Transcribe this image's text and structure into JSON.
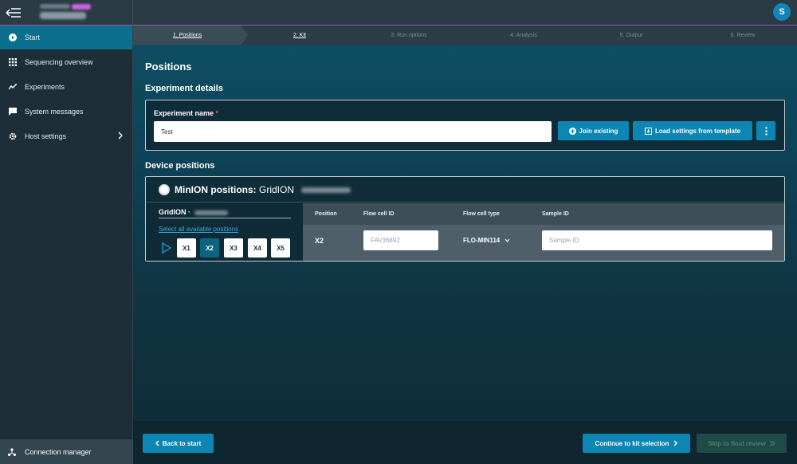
{
  "app": {
    "avatar_initial": "S"
  },
  "sidebar": {
    "items": [
      {
        "label": "Start",
        "icon": "play-circle-icon"
      },
      {
        "label": "Sequencing overview",
        "icon": "grid-icon"
      },
      {
        "label": "Experiments",
        "icon": "chart-line-icon"
      },
      {
        "label": "System messages",
        "icon": "message-icon"
      },
      {
        "label": "Host settings",
        "icon": "gear-icon"
      }
    ],
    "connection_manager": "Connection manager"
  },
  "steps": [
    {
      "label": "1. Positions",
      "state": "done"
    },
    {
      "label": "2. Kit",
      "state": "done"
    },
    {
      "label": "3. Run options",
      "state": "pending"
    },
    {
      "label": "4. Analysis",
      "state": "pending"
    },
    {
      "label": "5. Output",
      "state": "pending"
    },
    {
      "label": "6. Review",
      "state": "pending"
    }
  ],
  "page": {
    "title": "Positions",
    "experiment_section": "Experiment details",
    "experiment_name_label": "Experiment name",
    "required_marker": "*",
    "experiment_name_value": "Test",
    "join_existing": "Join existing",
    "load_template": "Load settings from template",
    "device_section": "Device positions"
  },
  "device": {
    "title_bold": "MinION positions:",
    "title_rest": "GridION",
    "grid_label": "GridION ·",
    "select_all": "Select all available positions",
    "positions": [
      "X1",
      "X2",
      "X3",
      "X4",
      "X5"
    ],
    "selected": "X2"
  },
  "table": {
    "headers": [
      "Position",
      "Flow cell ID",
      "Flow cell type",
      "Sample ID"
    ],
    "row": {
      "position": "X2",
      "flow_cell_id_placeholder": "FAV36892",
      "flow_cell_type": "FLO-MIN114",
      "sample_id_placeholder": "Sample ID"
    }
  },
  "footer": {
    "back": "Back to start",
    "continue": "Continue to kit selection",
    "skip": "Skip to final review"
  },
  "colors": {
    "accent": "#0d86b3",
    "active_nav": "#0d6f8e",
    "link": "#3ba8d6",
    "required": "#e05d5d"
  }
}
